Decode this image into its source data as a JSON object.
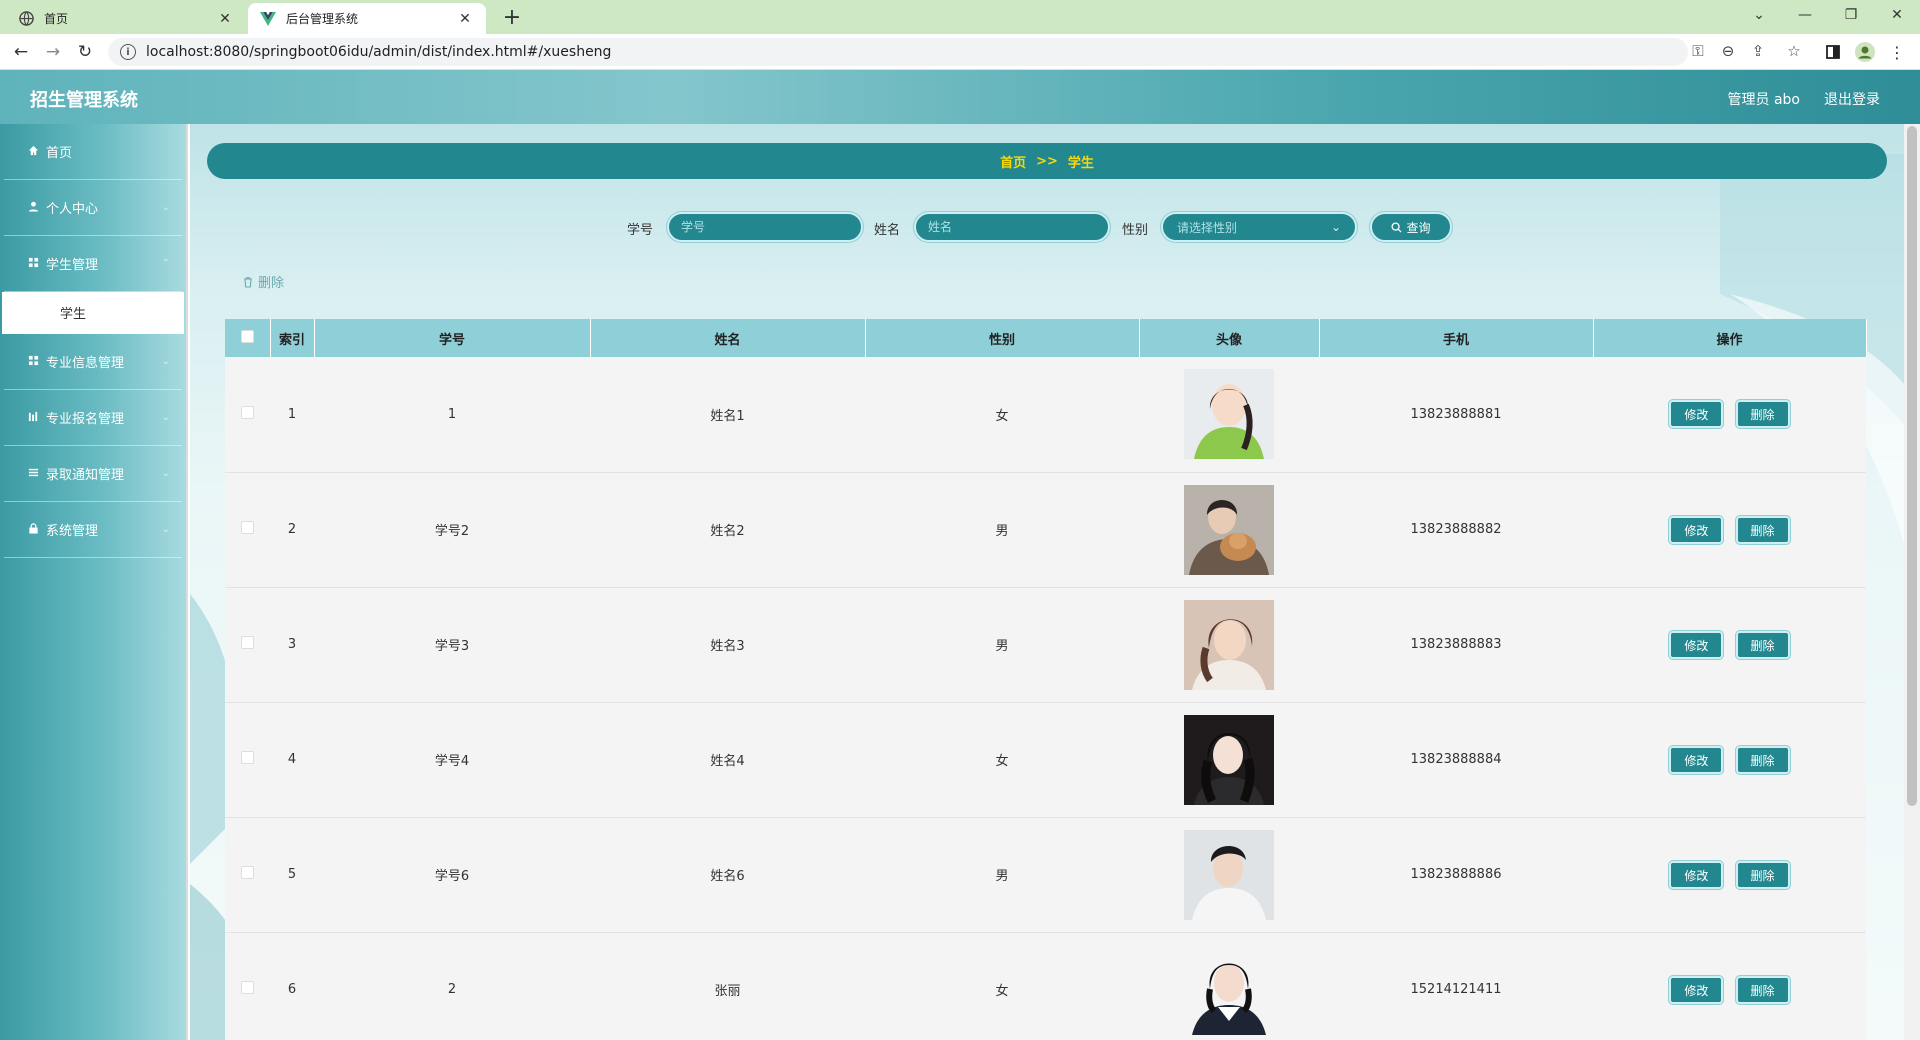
{
  "browser": {
    "tabs": [
      {
        "title": "首页"
      },
      {
        "title": "后台管理系统"
      }
    ],
    "url": "localhost:8080/springboot06idu/admin/dist/index.html#/xuesheng"
  },
  "header": {
    "title": "招生管理系统",
    "user": "管理员 abo",
    "logout": "退出登录"
  },
  "sidebar": {
    "items": [
      {
        "label": "首页",
        "icon": "home-icon"
      },
      {
        "label": "个人中心",
        "icon": "user-icon"
      },
      {
        "label": "学生管理",
        "icon": "grid-icon"
      },
      {
        "label": "专业信息管理",
        "icon": "grid-icon"
      },
      {
        "label": "专业报名管理",
        "icon": "chart-icon"
      },
      {
        "label": "录取通知管理",
        "icon": "list-icon"
      },
      {
        "label": "系统管理",
        "icon": "lock-icon"
      }
    ],
    "sub_active": "学生"
  },
  "breadcrumb": {
    "home": "首页",
    "sep": ">>",
    "current": "学生"
  },
  "search": {
    "xuehao_label": "学号",
    "xuehao_placeholder": "学号",
    "xingming_label": "姓名",
    "xingming_placeholder": "姓名",
    "xingbie_label": "性别",
    "xingbie_placeholder": "请选择性别",
    "query_label": "查询"
  },
  "bulk_delete": "删除",
  "table": {
    "headers": [
      "索引",
      "学号",
      "姓名",
      "性别",
      "头像",
      "手机",
      "操作"
    ],
    "rows": [
      {
        "index": "1",
        "xuehao": "1",
        "xingming": "姓名1",
        "xingbie": "女",
        "phone": "13823888881"
      },
      {
        "index": "2",
        "xuehao": "学号2",
        "xingming": "姓名2",
        "xingbie": "男",
        "phone": "13823888882"
      },
      {
        "index": "3",
        "xuehao": "学号3",
        "xingming": "姓名3",
        "xingbie": "男",
        "phone": "13823888883"
      },
      {
        "index": "4",
        "xuehao": "学号4",
        "xingming": "姓名4",
        "xingbie": "女",
        "phone": "13823888884"
      },
      {
        "index": "5",
        "xuehao": "学号6",
        "xingming": "姓名6",
        "xingbie": "男",
        "phone": "13823888886"
      },
      {
        "index": "6",
        "xuehao": "2",
        "xingming": "张丽",
        "xingbie": "女",
        "phone": "15214121411"
      }
    ],
    "edit_label": "修改",
    "delete_label": "删除"
  }
}
